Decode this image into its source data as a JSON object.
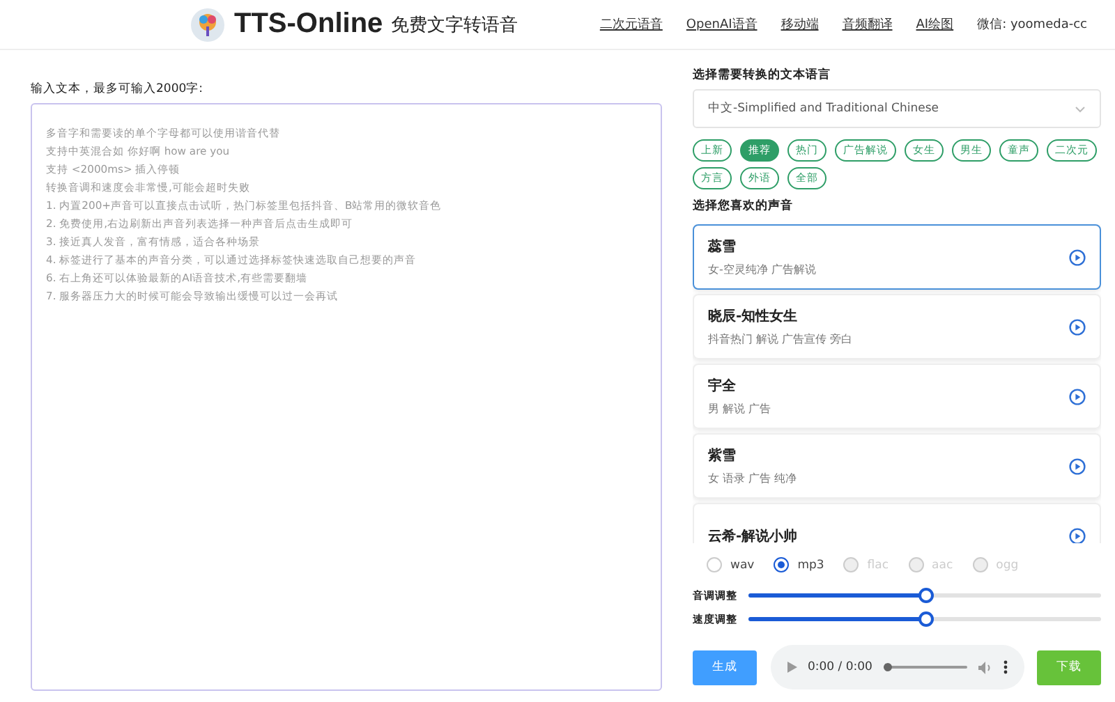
{
  "header": {
    "title": "TTS-Online",
    "subtitle": "免费文字转语音",
    "nav": [
      "二次元语音",
      "OpenAI语音",
      "移动端",
      "音频翻译",
      "AI绘图"
    ],
    "contact": "微信: yoomeda-cc"
  },
  "input": {
    "label": "输入文本，最多可输入2000字:",
    "placeholder_lines": [
      "多音字和需要读的单个字母都可以使用谐音代替",
      "支持中英混合如 你好啊 how are you",
      "支持 <2000ms> 插入停顿",
      "转换音调和速度会非常慢,可能会超时失败",
      "1. 内置200+声音可以直接点击试听，热门标签里包括抖音、B站常用的微软音色",
      "2. 免费使用,右边刷新出声音列表选择一种声音后点击生成即可",
      "3. 接近真人发音，富有情感，适合各种场景",
      "4. 标签进行了基本的声音分类，可以通过选择标签快速选取自己想要的声音",
      "6. 右上角还可以体验最新的AI语音技术,有些需要翻墙",
      "7. 服务器压力大的时候可能会导致输出缓慢可以过一会再试"
    ]
  },
  "language": {
    "label": "选择需要转换的文本语言",
    "value": "中文-Simplified and Traditional Chinese"
  },
  "tags": [
    {
      "label": "上新",
      "selected": false
    },
    {
      "label": "推荐",
      "selected": true
    },
    {
      "label": "热门",
      "selected": false
    },
    {
      "label": "广告解说",
      "selected": false
    },
    {
      "label": "女生",
      "selected": false
    },
    {
      "label": "男生",
      "selected": false
    },
    {
      "label": "童声",
      "selected": false
    },
    {
      "label": "二次元",
      "selected": false
    },
    {
      "label": "方言",
      "selected": false
    },
    {
      "label": "外语",
      "selected": false
    },
    {
      "label": "全部",
      "selected": false
    }
  ],
  "voices_label": "选择您喜欢的声音",
  "voices": [
    {
      "name": "蕊雪",
      "desc": "女-空灵纯净 广告解说",
      "selected": true
    },
    {
      "name": "晓辰-知性女生",
      "desc": "抖音热门 解说 广告宣传 旁白",
      "selected": false
    },
    {
      "name": "宇全",
      "desc": "男 解说 广告",
      "selected": false
    },
    {
      "name": "紫雪",
      "desc": "女 语录 广告 纯净",
      "selected": false
    },
    {
      "name": "云希-解说小帅"
    }
  ],
  "formats": [
    {
      "label": "wav",
      "selected": false,
      "disabled": false
    },
    {
      "label": "mp3",
      "selected": true,
      "disabled": false
    },
    {
      "label": "flac",
      "selected": false,
      "disabled": true
    },
    {
      "label": "aac",
      "selected": false,
      "disabled": true
    },
    {
      "label": "ogg",
      "selected": false,
      "disabled": true
    }
  ],
  "sliders": [
    {
      "label": "音调调整",
      "level": 0.5
    },
    {
      "label": "速度调整",
      "level": 0.5
    }
  ],
  "generate": "生成",
  "player": {
    "time": "0:00 / 0:00",
    "level": 0
  },
  "download": "下载"
}
